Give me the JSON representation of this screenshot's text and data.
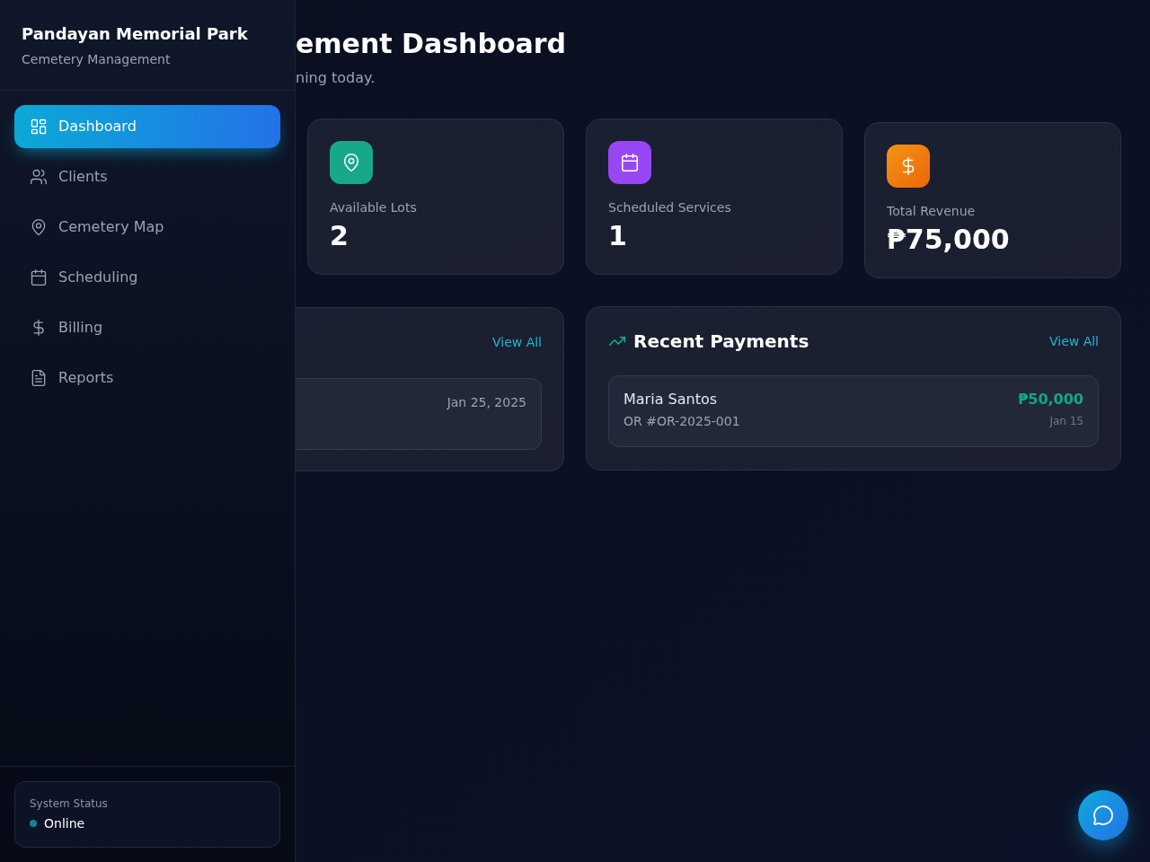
{
  "sidebar": {
    "title": "Pandayan Memorial Park",
    "subtitle": "Cemetery Management",
    "nav": [
      {
        "label": "Dashboard",
        "selected": true
      },
      {
        "label": "Clients",
        "selected": false
      },
      {
        "label": "Cemetery Map",
        "selected": false
      },
      {
        "label": "Scheduling",
        "selected": false
      },
      {
        "label": "Billing",
        "selected": false
      },
      {
        "label": "Reports",
        "selected": false
      }
    ],
    "status": {
      "label": "System Status",
      "value": "Online"
    }
  },
  "header": {
    "title": "ement Dashboard",
    "subtitle": "ning today."
  },
  "stats": [
    {
      "label": "Available Lots",
      "value": "2"
    },
    {
      "label": "Scheduled Services",
      "value": "1"
    },
    {
      "label": "Total Revenue",
      "value": "₱75,000"
    }
  ],
  "panels": [
    {
      "kind": "partial",
      "link": "View All",
      "rows": [
        {
          "date": "Jan 25, 2025"
        }
      ]
    },
    {
      "kind": "payments",
      "title": "Recent Payments",
      "link": "View All",
      "rows": [
        {
          "name": "Maria Santos",
          "reference": "OR #OR-2025-001",
          "amount": "₱50,000",
          "date": "Jan 15"
        }
      ]
    }
  ]
}
